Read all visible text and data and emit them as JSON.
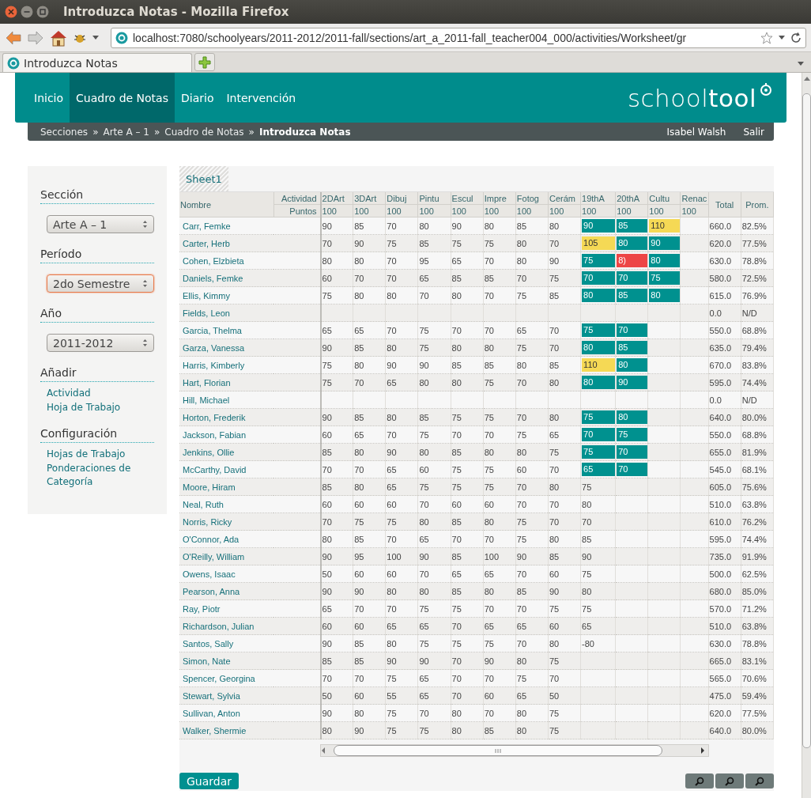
{
  "browser": {
    "title": "Introduzca Notas - Mozilla Firefox",
    "url": "localhost:7080/schoolyears/2011-2012/2011-fall/sections/art_a_2011-fall_teacher004_000/activities/Worksheet/gr",
    "tab": "Introduzca Notas"
  },
  "nav": {
    "items": [
      {
        "label": "Inicio",
        "selected": false
      },
      {
        "label": "Cuadro de Notas",
        "selected": true
      },
      {
        "label": "Diario",
        "selected": false
      },
      {
        "label": "Intervención",
        "selected": false
      }
    ],
    "logo": "school**tool**"
  },
  "breadcrumb": {
    "items": [
      "Secciones",
      "Arte A – 1",
      "Cuadro de Notas"
    ],
    "separators": [
      "»",
      "»",
      "»"
    ],
    "current": "Introduzca Notas",
    "user": "Isabel Walsh",
    "logout": "Salir"
  },
  "sidebar": {
    "sections": [
      {
        "title": "Sección",
        "kind": "select",
        "value": "Arte A – 1",
        "focused": false
      },
      {
        "title": "Período",
        "kind": "select",
        "value": "2do Semestre",
        "focused": true
      },
      {
        "title": "Año",
        "kind": "select",
        "value": "2011-2012",
        "focused": false
      },
      {
        "title": "Añadir",
        "kind": "links",
        "links": [
          "Actividad",
          "Hoja de Trabajo"
        ]
      },
      {
        "title": "Configuración",
        "kind": "links",
        "links": [
          "Hojas de Trabajo",
          "Ponderaciones de Categoría"
        ]
      }
    ]
  },
  "gradebook": {
    "tabs": [
      {
        "label": "Sheet1",
        "selected": true
      }
    ],
    "name_header": "Nombre",
    "activity_label": "Actividad",
    "points_label": "Puntos",
    "total_header": "Total",
    "average_header": "Prom.",
    "activities": [
      {
        "title": "2DArt",
        "points": "100"
      },
      {
        "title": "3DArt",
        "points": "100"
      },
      {
        "title": "Dibuj",
        "points": "100"
      },
      {
        "title": "Pintu",
        "points": "100"
      },
      {
        "title": "Escul",
        "points": "100"
      },
      {
        "title": "Impre",
        "points": "100"
      },
      {
        "title": "Fotog",
        "points": "100"
      },
      {
        "title": "Cerám",
        "points": "100"
      },
      {
        "title": "19thA",
        "points": "100"
      },
      {
        "title": "20thA",
        "points": "100"
      },
      {
        "title": "Cultu",
        "points": "100"
      },
      {
        "title": "Renac",
        "points": "100"
      }
    ],
    "rows": [
      {
        "name": "Carr, Femke",
        "scores": [
          "90",
          "85",
          "70",
          "80",
          "90",
          "80",
          "85",
          "80",
          {
            "kind": "input",
            "value": "90",
            "color": "#00918f"
          },
          {
            "kind": "input",
            "value": "85",
            "color": "#00918f"
          },
          {
            "kind": "input",
            "value": "110",
            "color": "#f5d955"
          },
          {
            "kind": "empty"
          }
        ],
        "total": "660.0",
        "average": "82.5%"
      },
      {
        "name": "Carter, Herb",
        "scores": [
          "70",
          "90",
          "75",
          "85",
          "75",
          "75",
          "80",
          "70",
          {
            "kind": "input",
            "value": "105",
            "color": "#f5d955"
          },
          {
            "kind": "input",
            "value": "80",
            "color": "#00918f"
          },
          {
            "kind": "input",
            "value": "90",
            "color": "#00918f"
          },
          {
            "kind": "empty"
          }
        ],
        "total": "620.0",
        "average": "77.5%"
      },
      {
        "name": "Cohen, Elzbieta",
        "scores": [
          "80",
          "80",
          "70",
          "95",
          "65",
          "70",
          "80",
          "90",
          {
            "kind": "input",
            "value": "75",
            "color": "#00918f"
          },
          {
            "kind": "input",
            "value": "8)",
            "color": "#ed4646"
          },
          {
            "kind": "input",
            "value": "80",
            "color": "#00918f"
          },
          {
            "kind": "empty"
          }
        ],
        "total": "630.0",
        "average": "78.8%"
      },
      {
        "name": "Daniels, Femke",
        "scores": [
          "60",
          "70",
          "70",
          "65",
          "85",
          "85",
          "70",
          "75",
          {
            "kind": "input",
            "value": "70",
            "color": "#00918f"
          },
          {
            "kind": "input",
            "value": "70",
            "color": "#00918f"
          },
          {
            "kind": "input",
            "value": "75",
            "color": "#00918f"
          },
          {
            "kind": "empty"
          }
        ],
        "total": "580.0",
        "average": "72.5%"
      },
      {
        "name": "Ellis, Kimmy",
        "scores": [
          "75",
          "80",
          "80",
          "70",
          "80",
          "70",
          "75",
          "85",
          {
            "kind": "input",
            "value": "80",
            "color": "#00918f"
          },
          {
            "kind": "input",
            "value": "85",
            "color": "#00918f"
          },
          {
            "kind": "input",
            "value": "80",
            "color": "#00918f"
          },
          {
            "kind": "empty"
          }
        ],
        "total": "615.0",
        "average": "76.9%"
      },
      {
        "name": "Fields, Leon",
        "scores": [
          {
            "kind": "empty"
          },
          {
            "kind": "empty"
          },
          {
            "kind": "empty"
          },
          {
            "kind": "empty"
          },
          {
            "kind": "empty"
          },
          {
            "kind": "empty"
          },
          {
            "kind": "empty"
          },
          {
            "kind": "empty"
          },
          {
            "kind": "empty"
          },
          {
            "kind": "empty"
          },
          {
            "kind": "empty"
          },
          {
            "kind": "empty"
          }
        ],
        "total": "0.0",
        "average": "N/D"
      },
      {
        "name": "Garcia, Thelma",
        "scores": [
          "65",
          "65",
          "70",
          "75",
          "70",
          "70",
          "65",
          "70",
          {
            "kind": "input",
            "value": "75",
            "color": "#00918f"
          },
          {
            "kind": "input",
            "value": "70",
            "color": "#00918f"
          },
          {
            "kind": "empty"
          },
          {
            "kind": "empty"
          }
        ],
        "total": "550.0",
        "average": "68.8%"
      },
      {
        "name": "Garza, Vanessa",
        "scores": [
          "90",
          "85",
          "80",
          "75",
          "80",
          "80",
          "75",
          "70",
          {
            "kind": "input",
            "value": "80",
            "color": "#00918f"
          },
          {
            "kind": "input",
            "value": "85",
            "color": "#00918f"
          },
          {
            "kind": "empty"
          },
          {
            "kind": "empty"
          }
        ],
        "total": "635.0",
        "average": "79.4%"
      },
      {
        "name": "Harris, Kimberly",
        "scores": [
          "75",
          "80",
          "90",
          "90",
          "85",
          "85",
          "80",
          "85",
          {
            "kind": "input",
            "value": "110",
            "color": "#f5d955"
          },
          {
            "kind": "input",
            "value": "80",
            "color": "#00918f"
          },
          {
            "kind": "empty"
          },
          {
            "kind": "empty"
          }
        ],
        "total": "670.0",
        "average": "83.8%"
      },
      {
        "name": "Hart, Florian",
        "scores": [
          "75",
          "70",
          "65",
          "80",
          "80",
          "75",
          "70",
          "80",
          {
            "kind": "input",
            "value": "80",
            "color": "#00918f"
          },
          {
            "kind": "input",
            "value": "90",
            "color": "#00918f"
          },
          {
            "kind": "empty"
          },
          {
            "kind": "empty"
          }
        ],
        "total": "595.0",
        "average": "74.4%"
      },
      {
        "name": "Hill, Michael",
        "scores": [
          {
            "kind": "empty"
          },
          {
            "kind": "empty"
          },
          {
            "kind": "empty"
          },
          {
            "kind": "empty"
          },
          {
            "kind": "empty"
          },
          {
            "kind": "empty"
          },
          {
            "kind": "empty"
          },
          {
            "kind": "empty"
          },
          {
            "kind": "empty"
          },
          {
            "kind": "empty"
          },
          {
            "kind": "empty"
          },
          {
            "kind": "empty"
          }
        ],
        "total": "0.0",
        "average": "N/D"
      },
      {
        "name": "Horton, Frederik",
        "scores": [
          "90",
          "85",
          "80",
          "85",
          "75",
          "75",
          "70",
          "80",
          {
            "kind": "input",
            "value": "75",
            "color": "#00918f"
          },
          {
            "kind": "input",
            "value": "80",
            "color": "#00918f"
          },
          {
            "kind": "empty"
          },
          {
            "kind": "empty"
          }
        ],
        "total": "640.0",
        "average": "80.0%"
      },
      {
        "name": "Jackson, Fabian",
        "scores": [
          "60",
          "65",
          "70",
          "75",
          "70",
          "70",
          "75",
          "65",
          {
            "kind": "input",
            "value": "70",
            "color": "#00918f"
          },
          {
            "kind": "input",
            "value": "75",
            "color": "#00918f"
          },
          {
            "kind": "empty"
          },
          {
            "kind": "empty"
          }
        ],
        "total": "550.0",
        "average": "68.8%"
      },
      {
        "name": "Jenkins, Ollie",
        "scores": [
          "85",
          "80",
          "90",
          "80",
          "85",
          "80",
          "80",
          "75",
          {
            "kind": "input",
            "value": "75",
            "color": "#00918f"
          },
          {
            "kind": "input",
            "value": "70",
            "color": "#00918f"
          },
          {
            "kind": "empty"
          },
          {
            "kind": "empty"
          }
        ],
        "total": "655.0",
        "average": "81.9%"
      },
      {
        "name": "McCarthy, David",
        "scores": [
          "70",
          "70",
          "65",
          "60",
          "75",
          "75",
          "60",
          "70",
          {
            "kind": "input",
            "value": "65",
            "color": "#00918f"
          },
          {
            "kind": "input",
            "value": "70",
            "color": "#00918f"
          },
          {
            "kind": "empty"
          },
          {
            "kind": "empty"
          }
        ],
        "total": "545.0",
        "average": "68.1%"
      },
      {
        "name": "Moore, Hiram",
        "scores": [
          "85",
          "80",
          "65",
          "75",
          "75",
          "75",
          "70",
          "80",
          "75",
          {
            "kind": "empty"
          },
          {
            "kind": "empty"
          },
          {
            "kind": "empty"
          }
        ],
        "total": "605.0",
        "average": "75.6%"
      },
      {
        "name": "Neal, Ruth",
        "scores": [
          "60",
          "60",
          "60",
          "70",
          "60",
          "60",
          "70",
          "70",
          "80",
          {
            "kind": "empty"
          },
          {
            "kind": "empty"
          },
          {
            "kind": "empty"
          }
        ],
        "total": "510.0",
        "average": "63.8%"
      },
      {
        "name": "Norris, Ricky",
        "scores": [
          "70",
          "75",
          "75",
          "80",
          "85",
          "80",
          "75",
          "70",
          "70",
          {
            "kind": "empty"
          },
          {
            "kind": "empty"
          },
          {
            "kind": "empty"
          }
        ],
        "total": "610.0",
        "average": "76.2%"
      },
      {
        "name": "O'Connor, Ada",
        "scores": [
          "80",
          "85",
          "70",
          "65",
          "70",
          "70",
          "75",
          "80",
          "85",
          {
            "kind": "empty"
          },
          {
            "kind": "empty"
          },
          {
            "kind": "empty"
          }
        ],
        "total": "595.0",
        "average": "74.4%"
      },
      {
        "name": "O'Reilly, William",
        "scores": [
          "90",
          "95",
          "100",
          "90",
          "85",
          "100",
          "90",
          "85",
          "90",
          {
            "kind": "empty"
          },
          {
            "kind": "empty"
          },
          {
            "kind": "empty"
          }
        ],
        "total": "735.0",
        "average": "91.9%"
      },
      {
        "name": "Owens, Isaac",
        "scores": [
          "50",
          "60",
          "60",
          "70",
          "65",
          "65",
          "70",
          "60",
          "75",
          {
            "kind": "empty"
          },
          {
            "kind": "empty"
          },
          {
            "kind": "empty"
          }
        ],
        "total": "500.0",
        "average": "62.5%"
      },
      {
        "name": "Pearson, Anna",
        "scores": [
          "90",
          "90",
          "80",
          "80",
          "85",
          "80",
          "85",
          "90",
          "80",
          {
            "kind": "empty"
          },
          {
            "kind": "empty"
          },
          {
            "kind": "empty"
          }
        ],
        "total": "680.0",
        "average": "85.0%"
      },
      {
        "name": "Ray, Piotr",
        "scores": [
          "65",
          "70",
          "70",
          "75",
          "75",
          "70",
          "70",
          "75",
          "75",
          {
            "kind": "empty"
          },
          {
            "kind": "empty"
          },
          {
            "kind": "empty"
          }
        ],
        "total": "570.0",
        "average": "71.2%"
      },
      {
        "name": "Richardson, Julian",
        "scores": [
          "60",
          "60",
          "65",
          "65",
          "70",
          "65",
          "65",
          "60",
          "65",
          {
            "kind": "empty"
          },
          {
            "kind": "empty"
          },
          {
            "kind": "empty"
          }
        ],
        "total": "510.0",
        "average": "63.8%"
      },
      {
        "name": "Santos, Sally",
        "scores": [
          "90",
          "85",
          "80",
          "75",
          "75",
          "75",
          "70",
          "80",
          "-80",
          {
            "kind": "empty"
          },
          {
            "kind": "empty"
          },
          {
            "kind": "empty"
          }
        ],
        "total": "630.0",
        "average": "78.8%"
      },
      {
        "name": "Simon, Nate",
        "scores": [
          "85",
          "85",
          "90",
          "90",
          "70",
          "90",
          "80",
          "75",
          {
            "kind": "empty"
          },
          {
            "kind": "empty"
          },
          {
            "kind": "empty"
          },
          {
            "kind": "empty"
          }
        ],
        "total": "665.0",
        "average": "83.1%"
      },
      {
        "name": "Spencer, Georgina",
        "scores": [
          "70",
          "70",
          "75",
          "65",
          "70",
          "70",
          "75",
          "70",
          {
            "kind": "empty"
          },
          {
            "kind": "empty"
          },
          {
            "kind": "empty"
          },
          {
            "kind": "empty"
          }
        ],
        "total": "565.0",
        "average": "70.6%"
      },
      {
        "name": "Stewart, Sylvia",
        "scores": [
          "50",
          "60",
          "55",
          "65",
          "70",
          "60",
          "65",
          "50",
          {
            "kind": "empty"
          },
          {
            "kind": "empty"
          },
          {
            "kind": "empty"
          },
          {
            "kind": "empty"
          }
        ],
        "total": "475.0",
        "average": "59.4%"
      },
      {
        "name": "Sullivan, Anton",
        "scores": [
          "90",
          "80",
          "75",
          "70",
          "80",
          "70",
          "80",
          "75",
          {
            "kind": "empty"
          },
          {
            "kind": "empty"
          },
          {
            "kind": "empty"
          },
          {
            "kind": "empty"
          }
        ],
        "total": "620.0",
        "average": "77.5%"
      },
      {
        "name": "Walker, Shermie",
        "scores": [
          "80",
          "90",
          "75",
          "75",
          "80",
          "85",
          "80",
          "75",
          {
            "kind": "empty"
          },
          {
            "kind": "empty"
          },
          {
            "kind": "empty"
          },
          {
            "kind": "empty"
          }
        ],
        "total": "640.0",
        "average": "80.0%"
      }
    ],
    "save_button": "Guardar"
  }
}
